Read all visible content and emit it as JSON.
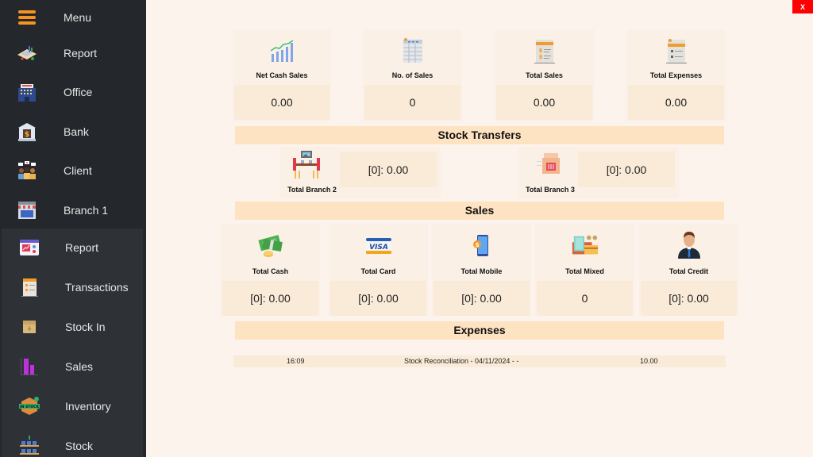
{
  "sidebar": {
    "items": [
      {
        "label": "Menu",
        "icon": "hamburger-icon"
      },
      {
        "label": "Report",
        "icon": "report-map-icon"
      },
      {
        "label": "Office",
        "icon": "office-building-icon"
      },
      {
        "label": "Bank",
        "icon": "bank-icon"
      },
      {
        "label": "Client",
        "icon": "client-group-icon"
      },
      {
        "label": "Branch 1",
        "icon": "store-icon"
      }
    ],
    "sub_items": [
      {
        "label": "Report",
        "icon": "report-chart-icon"
      },
      {
        "label": "Transactions",
        "icon": "transactions-doc-icon"
      },
      {
        "label": "Stock In",
        "icon": "box-icon"
      },
      {
        "label": "Sales",
        "icon": "bar-chart-icon"
      },
      {
        "label": "Inventory",
        "icon": "inventory-stock-icon"
      },
      {
        "label": "Stock",
        "icon": "shelf-icon"
      }
    ]
  },
  "close_button": {
    "label": "X",
    "color": "#ff0000"
  },
  "summary_cards": [
    {
      "label": "Net Cash Sales",
      "value": "0.00",
      "icon": "growth-chart-icon"
    },
    {
      "label": "No. of Sales",
      "value": "0",
      "icon": "spreadsheet-icon"
    },
    {
      "label": "Total Sales",
      "value": "0.00",
      "icon": "invoice-dollar-icon"
    },
    {
      "label": "Total Expenses",
      "value": "0.00",
      "icon": "expense-doc-icon"
    }
  ],
  "stock_transfers": {
    "title": "Stock Transfers",
    "items": [
      {
        "label": "Total Branch 2",
        "value": "[0]: 0.00",
        "icon": "dining-table-icon"
      },
      {
        "label": "Total Branch 3",
        "value": "[0]: 0.00",
        "icon": "food-bag-icon"
      }
    ]
  },
  "sales": {
    "title": "Sales",
    "items": [
      {
        "label": "Total Cash",
        "value": "[0]: 0.00",
        "icon": "cash-icon"
      },
      {
        "label": "Total Card",
        "value": "[0]: 0.00",
        "icon": "visa-card-icon"
      },
      {
        "label": "Total Mobile",
        "value": "[0]: 0.00",
        "icon": "mobile-pay-icon"
      },
      {
        "label": "Total Mixed",
        "value": "0",
        "icon": "mixed-payment-icon"
      },
      {
        "label": "Total Credit",
        "value": "[0]: 0.00",
        "icon": "person-credit-icon"
      }
    ]
  },
  "expenses": {
    "title": "Expenses",
    "rows": [
      {
        "time": "16:09",
        "description": "Stock Reconciliation - 04/11/2024  -  -",
        "amount": "10.00"
      }
    ]
  }
}
